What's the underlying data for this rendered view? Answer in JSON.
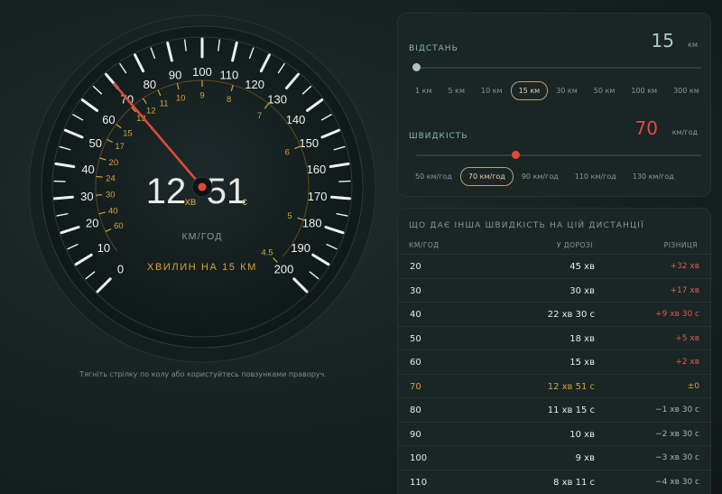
{
  "gauge": {
    "speed_ticks": [
      "0",
      "10",
      "20",
      "30",
      "40",
      "50",
      "60",
      "70",
      "80",
      "90",
      "100",
      "110",
      "120",
      "130",
      "140",
      "150",
      "160",
      "170",
      "180",
      "190",
      "200"
    ],
    "minute_ticks": [
      "60",
      "40",
      "30",
      "24",
      "20",
      "17",
      "15",
      "13",
      "12",
      "11",
      "10",
      "9",
      "8",
      "7",
      "6",
      "5",
      "4.5"
    ],
    "current_speed": 70,
    "time_minutes": "12",
    "minutes_unit": "хв",
    "time_seconds": "51",
    "seconds_unit": "с",
    "speed_unit": "КМ/ГОД",
    "caption": "ХВИЛИН НА 15 КМ",
    "hint": "Тягніть стрілку по колу або користуйтесь повзунками праворуч."
  },
  "distance": {
    "label": "ВІДСТАНЬ",
    "value": "15",
    "unit": "км",
    "slider_fraction": 0.0,
    "chips": [
      "1 км",
      "5 км",
      "10 км",
      "15 км",
      "30 км",
      "50 км",
      "100 км",
      "300 км"
    ],
    "active": "15 км"
  },
  "speed": {
    "label": "ШВИДКІСТЬ",
    "value": "70",
    "unit": "км/год",
    "slider_fraction": 0.35,
    "chips": [
      "50 км/год",
      "70 км/год",
      "90 км/год",
      "110 км/год",
      "130 км/год"
    ],
    "active": "70 км/год"
  },
  "table": {
    "title": "ЩО ДАЄ ІНША ШВИДКІСТЬ НА ЦІЙ ДИСТАНЦІЇ",
    "headers": [
      "КМ/ГОД",
      "У ДОРОЗІ",
      "РІЗНИЦЯ"
    ],
    "rows": [
      {
        "speed": "20",
        "time": "45 хв",
        "diff": "+32 хв",
        "kind": "worse"
      },
      {
        "speed": "30",
        "time": "30 хв",
        "diff": "+17 хв",
        "kind": "worse"
      },
      {
        "speed": "40",
        "time": "22 хв 30 с",
        "diff": "+9 хв 30 с",
        "kind": "worse"
      },
      {
        "speed": "50",
        "time": "18 хв",
        "diff": "+5 хв",
        "kind": "worse"
      },
      {
        "speed": "60",
        "time": "15 хв",
        "diff": "+2 хв",
        "kind": "worse"
      },
      {
        "speed": "70",
        "time": "12 хв 51 с",
        "diff": "±0",
        "kind": "current"
      },
      {
        "speed": "80",
        "time": "11 хв 15 с",
        "diff": "−1 хв 30 с",
        "kind": "better"
      },
      {
        "speed": "90",
        "time": "10 хв",
        "diff": "−2 хв 30 с",
        "kind": "better"
      },
      {
        "speed": "100",
        "time": "9 хв",
        "diff": "−3 хв 30 с",
        "kind": "better"
      },
      {
        "speed": "110",
        "time": "8 хв 11 с",
        "diff": "−4 хв 30 с",
        "kind": "better"
      }
    ]
  },
  "colors": {
    "accent_red": "#e04a3a",
    "accent_gold": "#d7a23a",
    "distance_value": "#a8d0c4",
    "thumb_distance": "#a9c8c0",
    "worse": "#e05a4a",
    "better": "#a7b2ae",
    "current": "#d7a23a",
    "text": "#e8ece8"
  }
}
